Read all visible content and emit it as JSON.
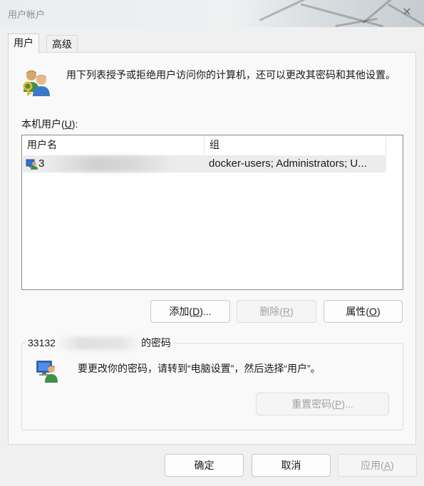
{
  "window": {
    "title": "用户帐户",
    "close_symbol": "✕"
  },
  "tabs": [
    {
      "label": "用户",
      "active": true
    },
    {
      "label": "高级",
      "active": false
    }
  ],
  "intro": {
    "text": "用下列表授予或拒绝用户访问你的计算机，还可以更改其密码和其他设置。",
    "icon": "users-icon"
  },
  "local_users": {
    "label_prefix": "本机用户(",
    "label_accel": "U",
    "label_suffix": "):",
    "columns": [
      "用户名",
      "组"
    ],
    "rows": [
      {
        "username": "3",
        "group": "docker-users; Administrators; U..."
      }
    ]
  },
  "buttons": {
    "add": {
      "prefix": "添加(",
      "accel": "D",
      "suffix": ")..."
    },
    "remove": {
      "prefix": "删除(",
      "accel": "R",
      "suffix": ")"
    },
    "properties": {
      "prefix": "属性(",
      "accel": "O",
      "suffix": ")"
    }
  },
  "password_group": {
    "caption_prefix": "33132",
    "caption_suffix": "的密码",
    "text": "要更改你的密码，请转到“电脑设置”，然后选择“用户”。",
    "reset": {
      "prefix": "重置密码(",
      "accel": "P",
      "suffix": ")..."
    }
  },
  "footer": {
    "ok": "确定",
    "cancel": "取消",
    "apply": {
      "prefix": "应用(",
      "accel": "A",
      "suffix": ")"
    }
  },
  "colors": {
    "dialog_bg": "#f0f0f0",
    "panel_bg": "#f9f9f9",
    "disabled_text": "#a2a2a2",
    "row_highlight": "#ececec"
  }
}
